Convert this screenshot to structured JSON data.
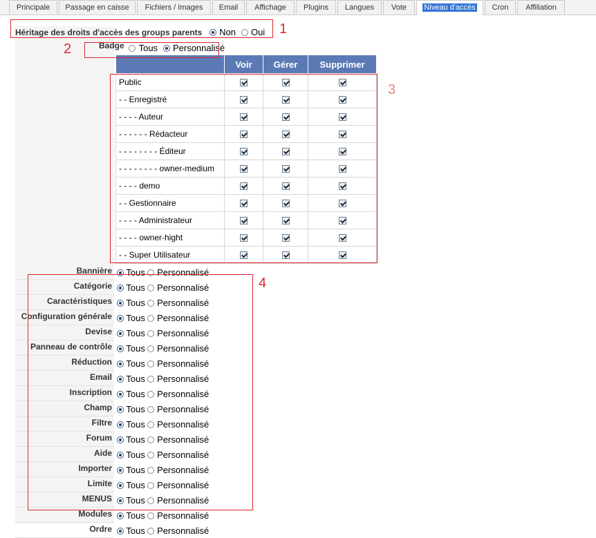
{
  "tabs": [
    {
      "label": "Principale"
    },
    {
      "label": "Passage en caisse"
    },
    {
      "label": "Fichiers / Images"
    },
    {
      "label": "Email"
    },
    {
      "label": "Affichage"
    },
    {
      "label": "Plugins"
    },
    {
      "label": "Langues"
    },
    {
      "label": "Vote"
    },
    {
      "label": "Niveau d'accès",
      "active": true
    },
    {
      "label": "Cron"
    },
    {
      "label": "Affiliation"
    }
  ],
  "inheritance": {
    "label": "Héritage des droits d'accès des groups parents",
    "option_no": "Non",
    "option_yes": "Oui",
    "selected": "Non"
  },
  "badge": {
    "label": "Badge",
    "option_all": "Tous",
    "option_custom": "Personnalisé",
    "selected": "Personnalisé"
  },
  "grid": {
    "headers": [
      "Voir",
      "Gérer",
      "Supprimer"
    ],
    "rows": [
      "Public",
      "- - Enregistré",
      "- - - - Auteur",
      "- - - - - - Rédacteur",
      "- - - - - - - - Éditeur",
      "- - - - - - - - owner-medium",
      "- - - - demo",
      "- - Gestionnaire",
      "- - - - Administrateur",
      "- - - - owner-hight",
      "- - Super Utilisateur"
    ]
  },
  "permissions": {
    "option_all": "Tous",
    "option_custom": "Personnalisé",
    "items": [
      "Bannière",
      "Catégorie",
      "Caractéristiques",
      "Configuration générale",
      "Devise",
      "Panneau de contrôle",
      "Réduction",
      "Email",
      "Inscription",
      "Champ",
      "Filtre",
      "Forum",
      "Aide",
      "Importer",
      "Limite",
      "MENUS",
      "Modules",
      "Ordre"
    ]
  },
  "annotations": [
    "1",
    "2",
    "3",
    "4"
  ],
  "colors": {
    "annotation_red": "#d9262c",
    "header_blue": "#5b7ab5",
    "active_tab": "#3375d6"
  }
}
